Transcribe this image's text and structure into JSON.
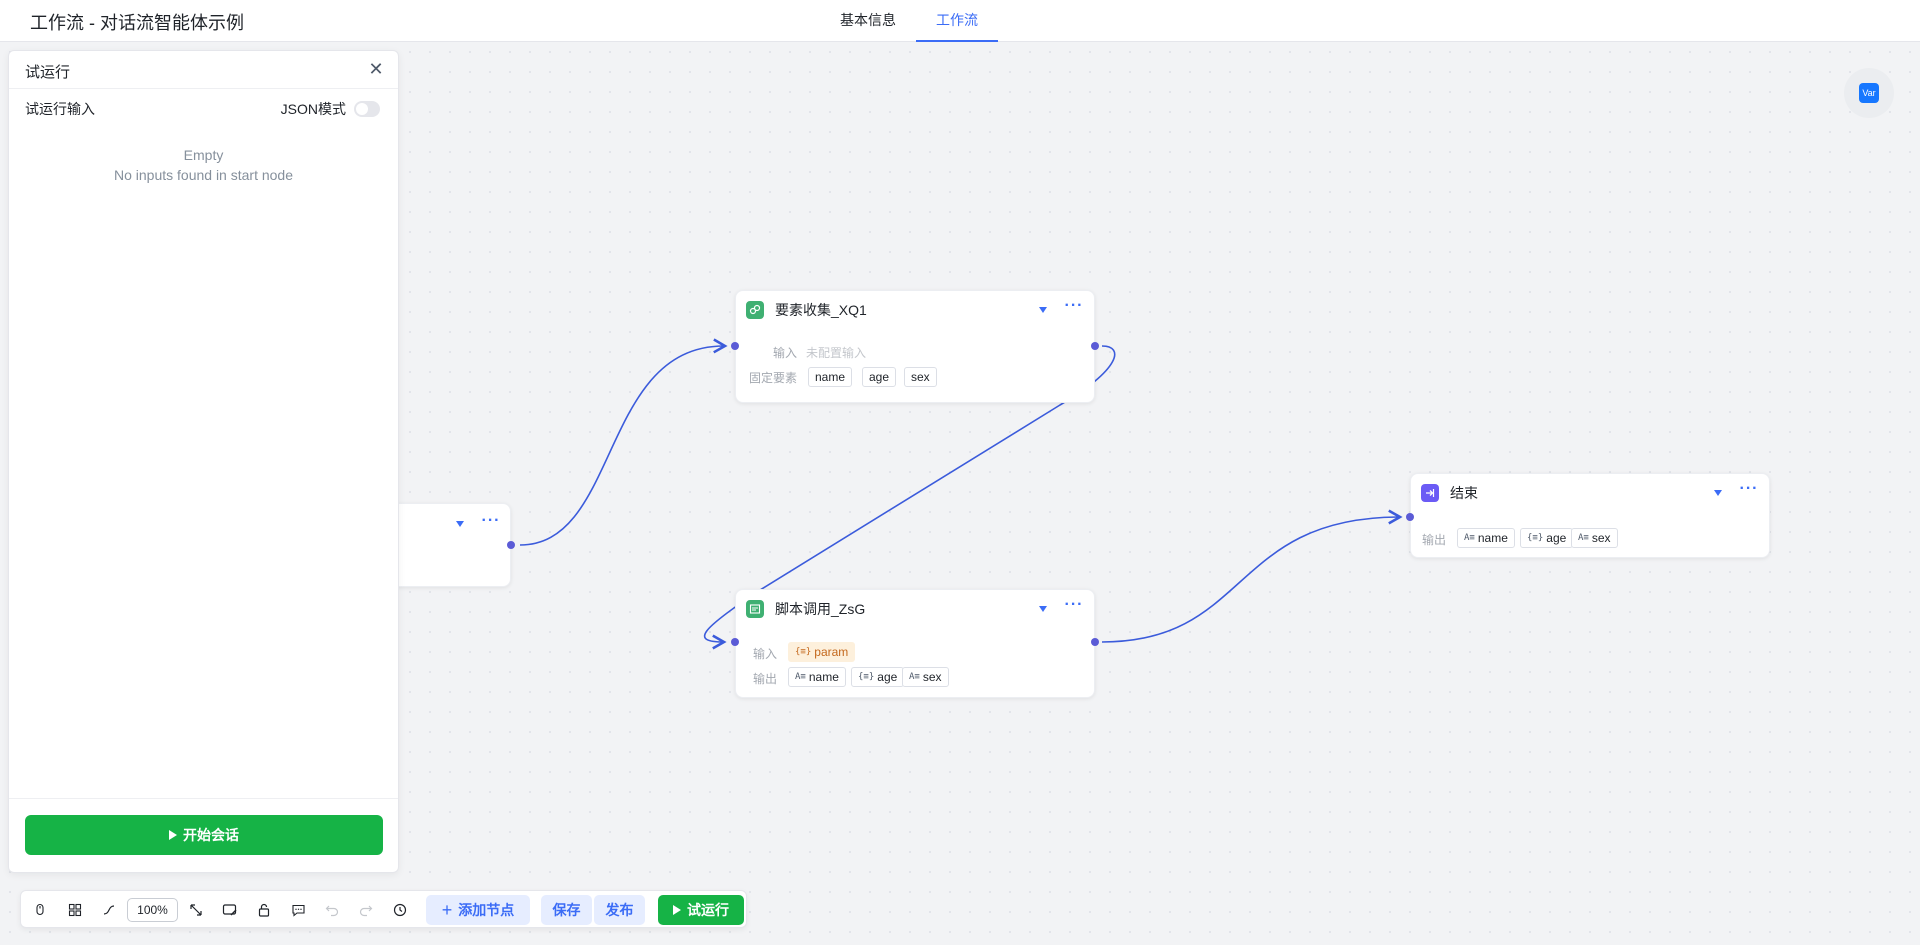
{
  "app": {
    "title": "工作流 - 对话流智能体示例"
  },
  "tabs": [
    {
      "label": "基本信息",
      "active": false
    },
    {
      "label": "工作流",
      "active": true
    }
  ],
  "panel": {
    "title": "试运行",
    "input_label": "试运行输入",
    "json_mode_label": "JSON模式",
    "json_mode_enabled": false,
    "empty_title": "Empty",
    "empty_desc": "No inputs found in start node",
    "start_button": "开始会话"
  },
  "nodes": {
    "collect": {
      "title": "要素收集_XQ1",
      "input_label": "输入",
      "input_placeholder": "未配置输入",
      "fixed_label": "固定要素",
      "fixed_tags": [
        "name",
        "age",
        "sex"
      ]
    },
    "script": {
      "title": "脚本调用_ZsG",
      "input_label": "输入",
      "input_tag": "param",
      "output_label": "输出",
      "output_tags": [
        "name",
        "age",
        "sex"
      ]
    },
    "end": {
      "title": "结束",
      "output_label": "输出",
      "output_tags": [
        "name",
        "age",
        "sex"
      ]
    }
  },
  "icons": {
    "string_type": "A≡",
    "object_type": "{≡}"
  },
  "var_button": {
    "label": "Var"
  },
  "toolbar": {
    "zoom": "100%",
    "add_node": "添加节点",
    "save": "保存",
    "publish": "发布",
    "test_run": "试运行"
  },
  "colors": {
    "accent": "#3b6cf6",
    "edge": "#3b5bdb",
    "port": "#5b5bd6",
    "run_green": "#16b346",
    "collect_icon": "#3fb072",
    "script_icon": "#3fb072",
    "end_icon": "#6b5bf5"
  }
}
